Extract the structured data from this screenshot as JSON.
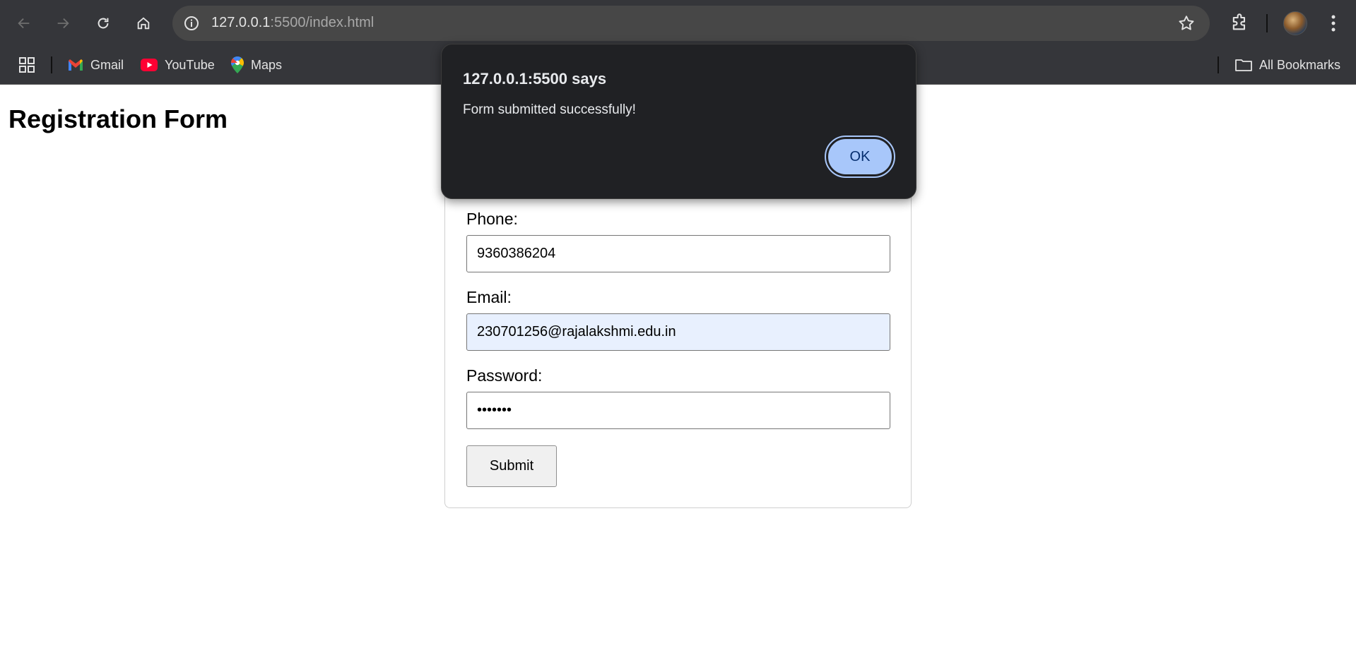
{
  "browser": {
    "url_host": "127.0.0.1",
    "url_path": ":5500/index.html",
    "bookmarks": [
      {
        "label": "Gmail",
        "icon": "gmail-icon"
      },
      {
        "label": "YouTube",
        "icon": "youtube-icon"
      },
      {
        "label": "Maps",
        "icon": "maps-icon"
      }
    ],
    "all_bookmarks_label": "All Bookmarks"
  },
  "page": {
    "title": "Registration Form",
    "fields": [
      {
        "label": "Phone:",
        "value": "9360386204",
        "type": "tel"
      },
      {
        "label": "Email:",
        "value": "230701256@rajalakshmi.edu.in",
        "type": "email"
      },
      {
        "label": "Password:",
        "value": "•••••••",
        "type": "password"
      }
    ],
    "submit_label": "Submit"
  },
  "dialog": {
    "title": "127.0.0.1:5500 says",
    "message": "Form submitted successfully!",
    "ok_label": "OK"
  },
  "colors": {
    "chrome_bg": "#35363a",
    "omnibox_bg": "#474747",
    "dialog_bg": "#202124",
    "ok_button": "#a8c7fa",
    "autofill_bg": "#e8f0fe"
  }
}
